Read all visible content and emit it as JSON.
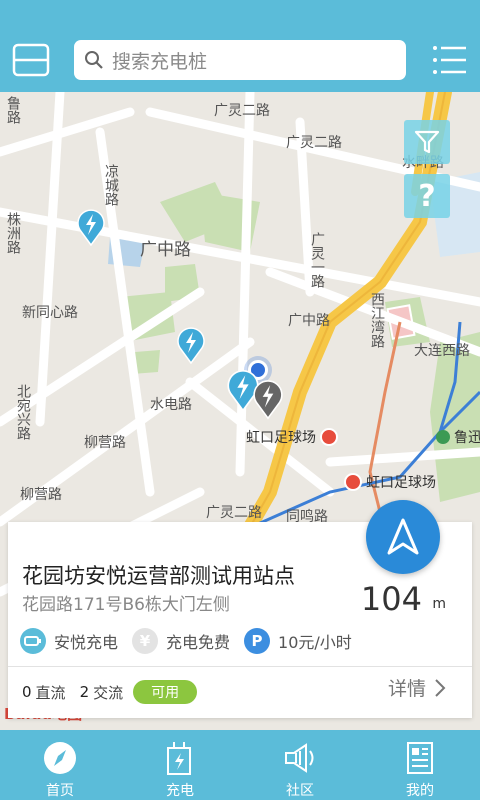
{
  "header": {
    "search_placeholder": "搜索充电桩"
  },
  "map": {
    "road_labels": {
      "guangling_er_lu_1": "广灵二路",
      "guangling_er_lu_2": "广灵二路",
      "guangzhong_lu": "广中路",
      "guangzhong_lu_2": "广中路",
      "liangcheng_lu": "凉城路",
      "zhuzhou_lu": "株洲路",
      "xintongxin_lu": "新同心路",
      "shuidian_lu": "水电路",
      "liuying_lu": "柳营路",
      "liuying_lu_2": "柳营路",
      "beiwanxing_lu": "北宛兴路",
      "guangling_yi_lu": "广灵一路",
      "xijiangwan_lu": "西江湾路",
      "dalianxi_lu": "大连西路",
      "tongming_lu": "同鸣路",
      "guangling_er_lu_3": "广灵二路",
      "luzhou_lu": "鲁路",
      "xiaozhou_lu": "水畔路",
      "top_left": "鲁路"
    },
    "pois": {
      "stadium_1": "虹口足球场",
      "stadium_2": "虹口足球场",
      "park": "鲁迅"
    },
    "help_label": "?",
    "baidu_logo": "Baidu地图"
  },
  "station": {
    "name": "花园坊安悦运营部测试用站点",
    "address": "花园路171号B6栋大门左侧",
    "distance": "104",
    "distance_unit": "m",
    "tags": {
      "operator": "安悦充电",
      "fee": "充电免费",
      "parking": "10元/小时"
    },
    "dc_count": "0",
    "dc_label": "直流",
    "ac_count": "2",
    "ac_label": "交流",
    "status": "可用",
    "details_label": "详情"
  },
  "colors": {
    "primary": "#5bbcd9",
    "pin": "#3fa9d8",
    "available": "#8cc63f",
    "nav_fab": "#2a8ad8"
  },
  "tabbar": {
    "home": "首页",
    "charge": "充电",
    "community": "社区",
    "mine": "我的"
  }
}
